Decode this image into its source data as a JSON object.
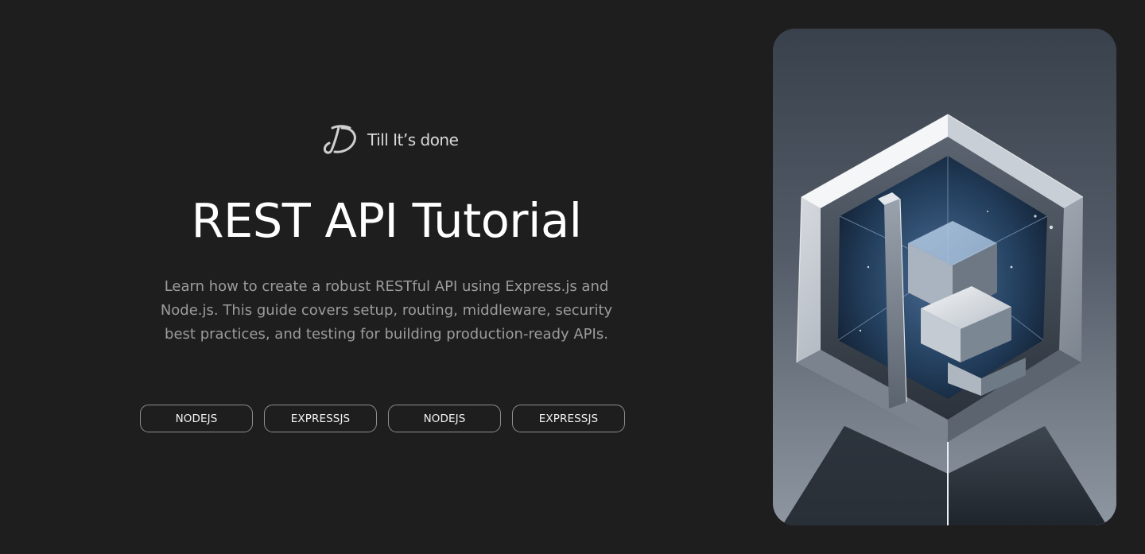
{
  "brand": {
    "name": "Till It’s done",
    "logo_icon": "td-monogram-icon"
  },
  "hero": {
    "title": "REST API Tutorial",
    "description": "Learn how to create a robust RESTful API using Express.js and Node.js. This guide covers setup, routing, middleware, security best practices, and testing for building production-ready APIs."
  },
  "tags": [
    {
      "label": "NODEJS"
    },
    {
      "label": "EXPRESSJS"
    },
    {
      "label": "NODEJS"
    },
    {
      "label": "EXPRESSJS"
    }
  ],
  "image": {
    "icon": "hexagon-crystal-illustration"
  },
  "colors": {
    "background": "#1e1e1e",
    "title": "#ffffff",
    "description": "#9c9c9c",
    "tag_border": "#8e8e8e",
    "accent_blue": "#2c4a70"
  }
}
